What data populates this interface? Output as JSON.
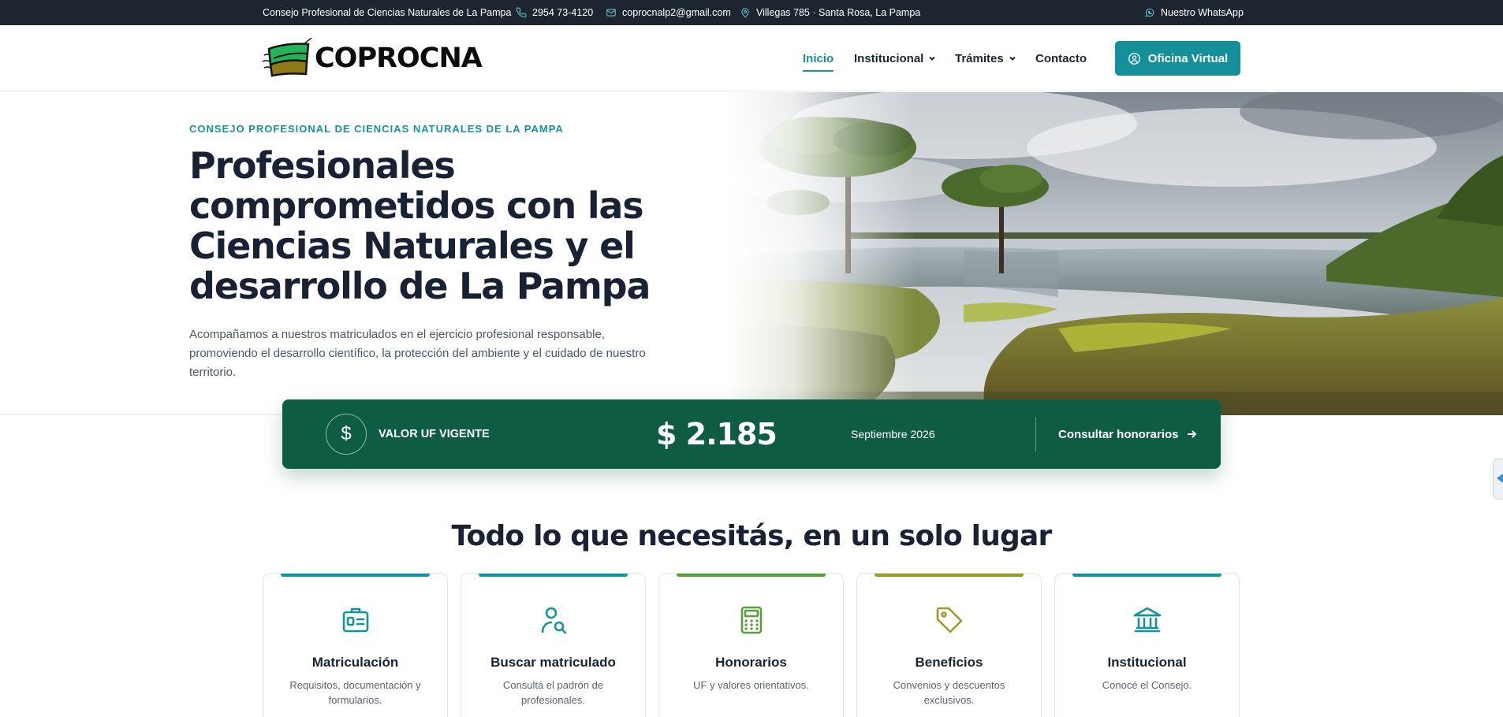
{
  "topbar": {
    "org_name": "Consejo Profesional de Ciencias Naturales de La Pampa",
    "phone": "2954 73-4120",
    "email": "coprocnalp2@gmail.com",
    "address": "Villegas 785 · Santa Rosa, La Pampa",
    "whatsapp": "Nuestro WhatsApp",
    "icons": [
      "phone-icon",
      "mail-icon",
      "location-icon",
      "whatsapp-icon"
    ]
  },
  "header": {
    "logo_text": "COPROCNA",
    "nav": [
      {
        "label": "Inicio",
        "active": true
      },
      {
        "label": "Institucional",
        "dropdown": true
      },
      {
        "label": "Trámites",
        "dropdown": true
      },
      {
        "label": "Contacto"
      }
    ],
    "cta_label": "Oficina Virtual"
  },
  "hero": {
    "eyebrow": "CONSEJO PROFESIONAL DE CIENCIAS NATURALES DE LA PAMPA",
    "title": "Profesionales comprometidos con las Ciencias Naturales y el desarrollo de La Pampa",
    "description": "Acompañamos a nuestros matriculados en el ejercicio profesional responsable, promoviendo el desarrollo científico, la protección del ambiente y el cuidado de nuestro territorio."
  },
  "uf": {
    "icon_symbol": "$",
    "label": "VALOR UF VIGENTE",
    "value": "$ 2.185",
    "month": "Septiembre 2026",
    "link_label": "Consultar honorarios"
  },
  "services": {
    "title": "Todo lo que necesitás, en un solo lugar",
    "cards": [
      {
        "title": "Matriculación",
        "desc": "Requisitos, documentación y formularios.",
        "color": "#14939b",
        "icon": "id-card-icon"
      },
      {
        "title": "Buscar matriculado",
        "desc": "Consultá el padrón de profesionales.",
        "color": "#14939b",
        "icon": "user-search-icon"
      },
      {
        "title": "Honorarios",
        "desc": "UF y valores orientativos.",
        "color": "#5a9e3a",
        "icon": "calculator-icon"
      },
      {
        "title": "Beneficios",
        "desc": "Convenios y descuentos exclusivos.",
        "color": "#9c9c2c",
        "icon": "tag-icon"
      },
      {
        "title": "Institucional",
        "desc": "Conocé el Consejo.",
        "color": "#14939b",
        "icon": "institution-icon"
      }
    ]
  },
  "colors": {
    "topbar_bg": "#1d2630",
    "accent": "#14939b",
    "uf_bg": "#0f5c44",
    "heading": "#182234"
  }
}
